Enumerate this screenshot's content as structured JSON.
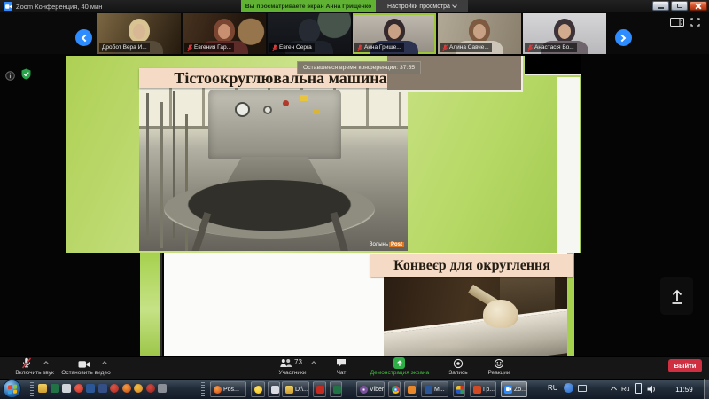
{
  "colors": {
    "viewing_banner_green": "#5fb232",
    "slide_green": "#b5d55e",
    "banner_peach": "#f5dac5",
    "leave_red": "#cf2f40",
    "zoom_blue": "#2d8cff",
    "active_speaker_border": "#9dc53a"
  },
  "titlebar": {
    "title": "Zoom Конференция, 40 мин",
    "viewing_banner": "Вы просматриваете экран Анна Грищенко",
    "view_settings": "Настройки просмотра"
  },
  "video_strip": {
    "participants": [
      {
        "name": "Дробот Вера И...",
        "muted": false,
        "active": false
      },
      {
        "name": "Евгения Гар...",
        "muted": true,
        "active": false
      },
      {
        "name": "Евген Серга",
        "muted": true,
        "active": false
      },
      {
        "name": "Анна Грище...",
        "muted": true,
        "active": true
      },
      {
        "name": "Алина Савче...",
        "muted": true,
        "active": false
      },
      {
        "name": "Анастасія Во...",
        "muted": true,
        "active": false
      }
    ]
  },
  "shared_screen": {
    "remaining_time_tooltip": "Оставшееся время конференции: 37:55",
    "slide1_title": "Тістоокруглювальна машина",
    "slide2_title": "Конвеєр для округлення",
    "watermark_text": "Волынь",
    "watermark_accent": "Post"
  },
  "toolbar": {
    "unmute_label": "Включить звук",
    "stop_video_label": "Остановить видео",
    "participants_label": "Участники",
    "participants_count": "73",
    "chat_label": "Чат",
    "share_label": "Демонстрация экрана",
    "record_label": "Запись",
    "reactions_label": "Реакции",
    "leave_label": "Выйти"
  },
  "taskbar": {
    "buttons": [
      {
        "label": "Pos..."
      },
      {
        "label": ""
      },
      {
        "label": ""
      },
      {
        "label": "D:\\..."
      },
      {
        "label": ""
      },
      {
        "label": ""
      },
      {
        "label": "Viber"
      },
      {
        "label": ""
      },
      {
        "label": ""
      },
      {
        "label": "M..."
      },
      {
        "label": ""
      },
      {
        "label": "Гр..."
      },
      {
        "label": "Zo..."
      }
    ],
    "language_indicator": "RU",
    "tray_language": "Ru",
    "clock": "11:59"
  }
}
